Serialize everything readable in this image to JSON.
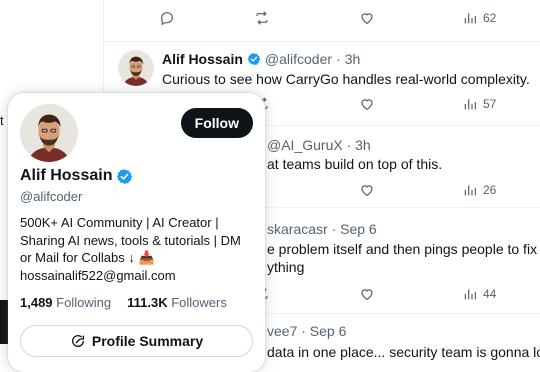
{
  "colors": {
    "verified": "#1d9bf0",
    "text": "#0f1419",
    "muted": "#536471",
    "border": "#eff3f4"
  },
  "left_edge": {
    "char": "t"
  },
  "tweets": [
    {
      "views": "62"
    },
    {
      "author_name": "Alif Hossain",
      "handle": "@alifcoder",
      "dot": "·",
      "time": "3h",
      "text": "Curious to see how CarryGo handles real-world complexity.",
      "views": "57"
    },
    {
      "head": "@AI_GuruX · 3h",
      "text": "at teams build on top of this.",
      "views": "26"
    },
    {
      "head": "skaracasr · Sep 6",
      "text_line1": "e problem itself and then pings people to fix it  o",
      "text_line2": "ything",
      "views": "44"
    },
    {
      "head": "vee7 · Sep 6",
      "text": "data in one place... security team is gonna love t"
    }
  ],
  "hover_card": {
    "follow_label": "Follow",
    "name": "Alif Hossain",
    "handle": "@alifcoder",
    "bio_lines": [
      "500K+ AI Community | AI Creator |",
      "Sharing AI news, tools & tutorials | DM",
      "or Mail for Collabs ↓ 📥",
      "hossainalif522@gmail.com"
    ],
    "following_count": "1,489",
    "following_label": "Following",
    "followers_count": "111.3K",
    "followers_label": "Followers",
    "summary_label": "Profile Summary"
  }
}
